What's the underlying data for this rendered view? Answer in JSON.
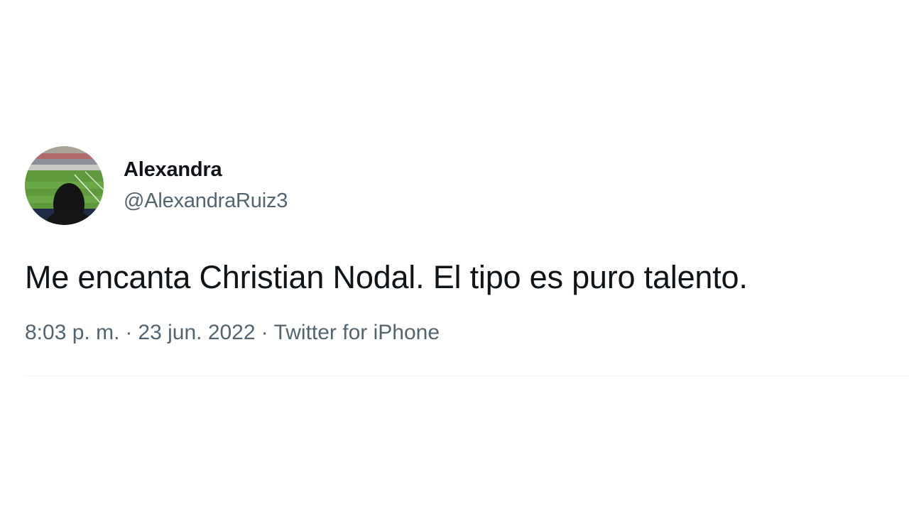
{
  "author": {
    "display_name": "Alexandra",
    "handle": "@AlexandraRuiz3",
    "avatar_icon": "stadium-profile-photo"
  },
  "tweet": {
    "text": "Me encanta Christian Nodal. El tipo es puro talento."
  },
  "meta": {
    "time": "8:03 p. m.",
    "separator": "·",
    "date": "23 jun. 2022",
    "source": "Twitter for iPhone"
  },
  "colors": {
    "primary_text": "#0f1419",
    "secondary_text": "#536471",
    "divider": "#eff3f4"
  }
}
